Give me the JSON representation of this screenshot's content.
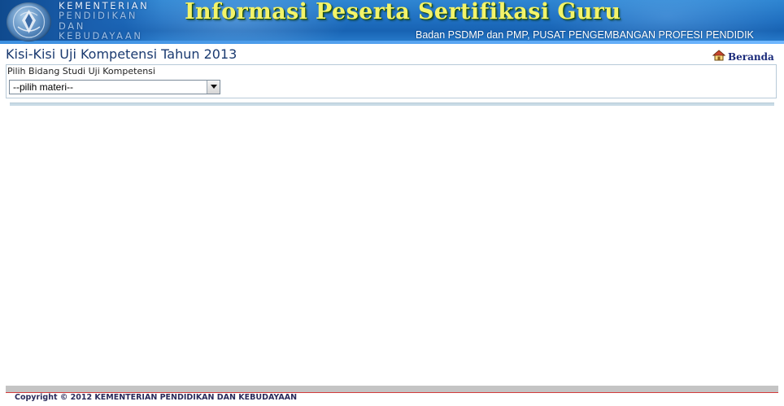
{
  "header": {
    "ministry_lines": [
      "KEMENTERIAN",
      "PENDIDIKAN",
      "DAN",
      "KEBUDAYAAN"
    ],
    "title": "Informasi Peserta Sertifikasi Guru",
    "subtitle": "Badan PSDMP dan PMP, PUSAT PENGEMBANGAN PROFESI PENDIDIK"
  },
  "page": {
    "title": "Kisi-Kisi Uji Kompetensi Tahun 2013",
    "home_link": "Beranda"
  },
  "form": {
    "label": "Pilih Bidang Studi Uji Kompetensi",
    "select_value": "--pilih materi--"
  },
  "footer": {
    "copyright": "Copyright © 2012 KEMENTERIAN PENDIDIKAN DAN KEBUDAYAAN"
  },
  "colors": {
    "banner_blue": "#1f6fc0",
    "title_yellow": "#f3f36a",
    "page_title": "#1a3a70",
    "footer_rule": "#d23a3a"
  }
}
